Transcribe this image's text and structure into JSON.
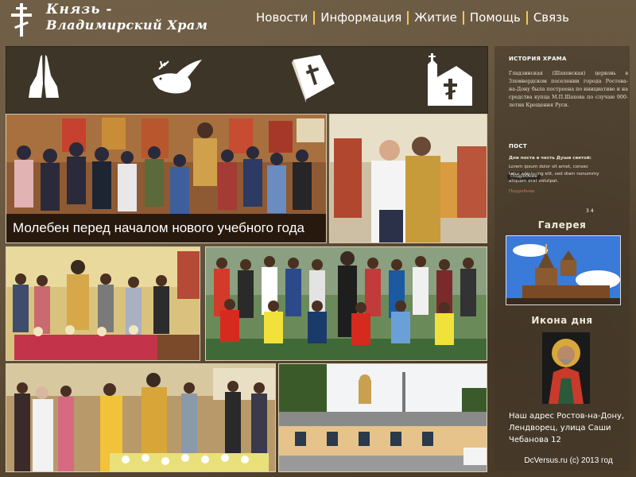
{
  "site": {
    "title_line1": "Князь -",
    "title_line2": "Владимирский Храм"
  },
  "nav": [
    {
      "label": "Новости"
    },
    {
      "label": "Информация"
    },
    {
      "label": "Житие"
    },
    {
      "label": "Помощь"
    },
    {
      "label": "Связь"
    }
  ],
  "icons": [
    "praying-hands-icon",
    "dove-icon",
    "bible-icon",
    "church-icon"
  ],
  "featured": {
    "caption": "Молебен перед началом нового учебного года"
  },
  "sidebar": {
    "history_title": "ИСТОРИЯ ХРАМА",
    "history_text": "Гладзинская (Шаховская) церковь в Злемвердском поселении города Ростова-на-Дону была построена по инициативе и на средства купца М.П.Шахова по случаю 900-летия Крещения Руси.",
    "more_label": "Подробнее",
    "post_title": "ПОСТ",
    "post_line1": "Дни поста в честь Души святой:",
    "post_line2": "Lorem ipsum dolor sit amet, consec",
    "post_line3": "tetur adipiscing elit, sed diam nonummy",
    "post_line4": "aliquam erat volutpat.",
    "post_more": "Подробнее",
    "pager": "3   4",
    "gallery_title": "Галерея",
    "icon_day_title": "Икона дня",
    "address": "Наш адрес Ростов-на-Дону, Лендворец, улица Саши Чебанова 12",
    "footer": "DcVersus.ru (c) 2013 год"
  }
}
